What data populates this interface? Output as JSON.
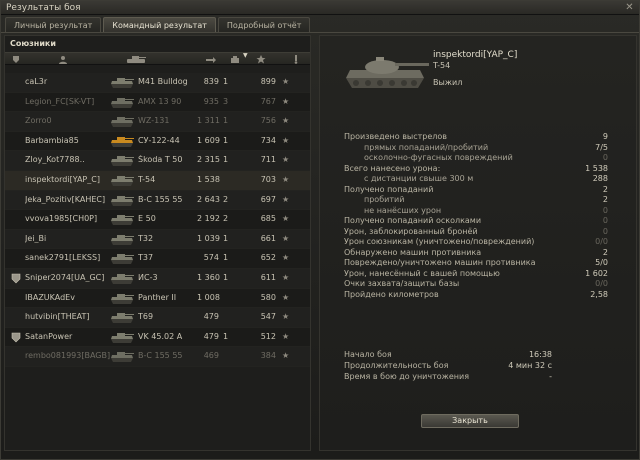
{
  "window": {
    "title": "Результаты боя",
    "close_glyph": "✕"
  },
  "tabs": [
    {
      "label": "Личный результат",
      "active": false
    },
    {
      "label": "Командный результат",
      "active": true
    },
    {
      "label": "Подробный отчёт",
      "active": false
    }
  ],
  "allies": {
    "title": "Союзники",
    "header_icons": [
      "squad-icon",
      "player-icon",
      "tank-icon",
      "damage-icon",
      "kills-icon",
      "xp-icon",
      "star-icon",
      "medal-icon"
    ],
    "rows": [
      {
        "player": "caL3r",
        "tank": "M41 Bulldog",
        "damage": "839",
        "kills": "1",
        "xp": "899",
        "squad": false,
        "dead": false,
        "selected": false,
        "tank_color": "#7d7d6e"
      },
      {
        "player": "Legion_FC[SK-VT]",
        "tank": "AMX 13 90",
        "damage": "935",
        "kills": "3",
        "xp": "767",
        "squad": false,
        "dead": true,
        "selected": false,
        "tank_color": "#6e6e62"
      },
      {
        "player": "Zorro0",
        "tank": "WZ-131",
        "damage": "1 311",
        "kills": "1",
        "xp": "756",
        "squad": false,
        "dead": true,
        "selected": false,
        "tank_color": "#6e6e62"
      },
      {
        "player": "Barbambia85",
        "tank": "СУ-122-44",
        "damage": "1 609",
        "kills": "1",
        "xp": "734",
        "squad": false,
        "dead": false,
        "selected": false,
        "tank_color": "#c98a1f"
      },
      {
        "player": "Zloy_Kot7788..",
        "tank": "Škoda T 50",
        "damage": "2 315",
        "kills": "1",
        "xp": "711",
        "squad": false,
        "dead": false,
        "selected": false,
        "tank_color": "#7d7d6e"
      },
      {
        "player": "inspektordi[YAP_C]",
        "tank": "T-54",
        "damage": "1 538",
        "kills": "",
        "xp": "703",
        "squad": false,
        "dead": false,
        "selected": true,
        "tank_color": "#7d7d6e"
      },
      {
        "player": "Jeka_Pozitiv[KAHEC]",
        "tank": "B-C 155 55",
        "damage": "2 643",
        "kills": "2",
        "xp": "697",
        "squad": false,
        "dead": false,
        "selected": false,
        "tank_color": "#7d7d6e"
      },
      {
        "player": "vvova1985[CH0P]",
        "tank": "E 50",
        "damage": "2 192",
        "kills": "2",
        "xp": "685",
        "squad": false,
        "dead": false,
        "selected": false,
        "tank_color": "#7d7d6e"
      },
      {
        "player": "Jei_Bi",
        "tank": "T32",
        "damage": "1 039",
        "kills": "1",
        "xp": "661",
        "squad": false,
        "dead": false,
        "selected": false,
        "tank_color": "#7d7d6e"
      },
      {
        "player": "sanek2791[LEKSS]",
        "tank": "T37",
        "damage": "574",
        "kills": "1",
        "xp": "652",
        "squad": false,
        "dead": false,
        "selected": false,
        "tank_color": "#7d7d6e"
      },
      {
        "player": "Sniper2074[UA_GC]",
        "tank": "ИС-3",
        "damage": "1 360",
        "kills": "1",
        "xp": "611",
        "squad": true,
        "dead": false,
        "selected": false,
        "tank_color": "#7d7d6e"
      },
      {
        "player": "IBAZUKAdEv",
        "tank": "Panther II",
        "damage": "1 008",
        "kills": "",
        "xp": "580",
        "squad": false,
        "dead": false,
        "selected": false,
        "tank_color": "#7d7d6e"
      },
      {
        "player": "hutvibin[THEAT]",
        "tank": "T69",
        "damage": "479",
        "kills": "",
        "xp": "547",
        "squad": false,
        "dead": false,
        "selected": false,
        "tank_color": "#7d7d6e"
      },
      {
        "player": "SatanPower",
        "tank": "VK 45.02 A",
        "damage": "479",
        "kills": "1",
        "xp": "512",
        "squad": true,
        "dead": false,
        "selected": false,
        "tank_color": "#7d7d6e"
      },
      {
        "player": "rembo081993[BAGB]",
        "tank": "B-C 155 55",
        "damage": "469",
        "kills": "",
        "xp": "384",
        "squad": false,
        "dead": true,
        "selected": false,
        "tank_color": "#6e6e62"
      }
    ]
  },
  "details": {
    "player": "inspektordi[YAP_C]",
    "tank": "T-54",
    "status": "Выжил",
    "stats": [
      {
        "label": "Произведено выстрелов",
        "value": "9",
        "indent": false,
        "zero": false
      },
      {
        "label": "прямых попаданий/пробитий",
        "value": "7/5",
        "indent": true,
        "zero": false
      },
      {
        "label": "осколочно-фугасных повреждений",
        "value": "0",
        "indent": true,
        "zero": true
      },
      {
        "label": "Всего нанесено урона:",
        "value": "1 538",
        "indent": false,
        "zero": false
      },
      {
        "label": "с дистанции свыше 300 м",
        "value": "288",
        "indent": true,
        "zero": false
      },
      {
        "label": "Получено попаданий",
        "value": "2",
        "indent": false,
        "zero": false
      },
      {
        "label": "пробитий",
        "value": "2",
        "indent": true,
        "zero": false
      },
      {
        "label": "не нанёсших урон",
        "value": "0",
        "indent": true,
        "zero": true
      },
      {
        "label": "Получено попаданий осколками",
        "value": "0",
        "indent": false,
        "zero": true
      },
      {
        "label": "Урон, заблокированный бронёй",
        "value": "0",
        "indent": false,
        "zero": true
      },
      {
        "label": "Урон союзникам (уничтожено/повреждений)",
        "value": "0/0",
        "indent": false,
        "zero": true
      },
      {
        "label": "Обнаружено машин противника",
        "value": "2",
        "indent": false,
        "zero": false
      },
      {
        "label": "Повреждено/уничтожено машин противника",
        "value": "5/0",
        "indent": false,
        "zero": false
      },
      {
        "label": "Урон, нанесённый с вашей помощью",
        "value": "1 602",
        "indent": false,
        "zero": false
      },
      {
        "label": "Очки захвата/защиты базы",
        "value": "0/0",
        "indent": false,
        "zero": true
      },
      {
        "label": "Пройдено километров",
        "value": "2,58",
        "indent": false,
        "zero": false
      }
    ],
    "timing": [
      {
        "label": "Начало боя",
        "value": "16:38"
      },
      {
        "label": "Продолжительность боя",
        "value": "4 мин 32 с"
      },
      {
        "label": "Время в бою до уничтожения",
        "value": "-"
      }
    ],
    "close_label": "Закрыть"
  }
}
